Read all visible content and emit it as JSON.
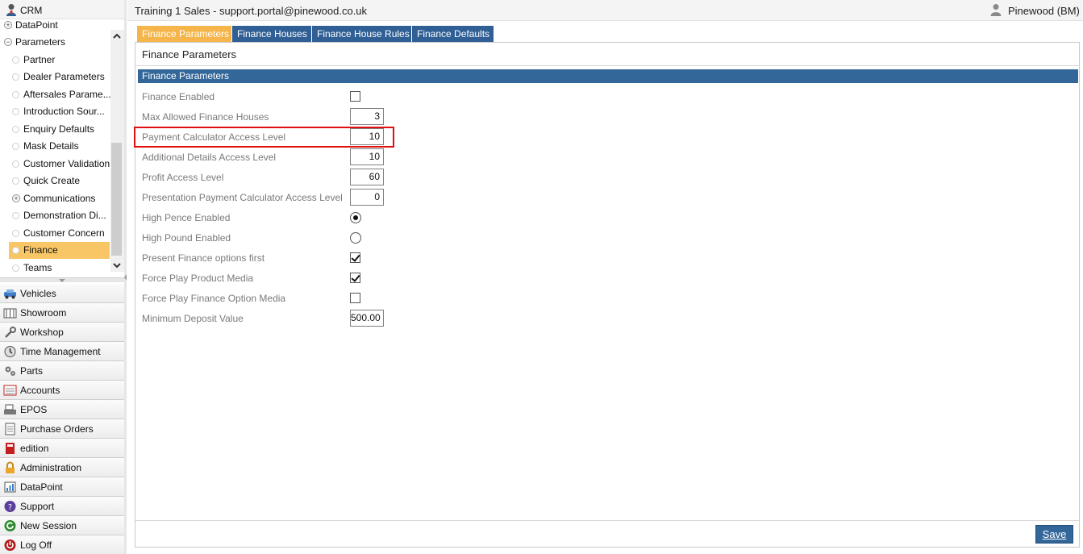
{
  "left_panel": {
    "header": {
      "label": "CRM"
    },
    "tree": [
      {
        "label": "DataPoint",
        "kind": "expandable",
        "symbol": "+"
      },
      {
        "label": "Parameters",
        "kind": "expandable",
        "symbol": "−"
      },
      {
        "label": "Partner",
        "kind": "leaf"
      },
      {
        "label": "Dealer Parameters",
        "kind": "leaf"
      },
      {
        "label": "Aftersales Parame...",
        "kind": "leaf"
      },
      {
        "label": "Introduction Sour...",
        "kind": "leaf"
      },
      {
        "label": "Enquiry Defaults",
        "kind": "leaf"
      },
      {
        "label": "Mask Details",
        "kind": "leaf"
      },
      {
        "label": "Customer Validation",
        "kind": "leaf"
      },
      {
        "label": "Quick Create",
        "kind": "leaf"
      },
      {
        "label": "Communications",
        "kind": "expandable",
        "symbol": "+"
      },
      {
        "label": "Demonstration Di...",
        "kind": "leaf"
      },
      {
        "label": "Customer Concern",
        "kind": "leaf"
      },
      {
        "label": "Finance",
        "kind": "leaf",
        "selected": true
      },
      {
        "label": "Teams",
        "kind": "leaf"
      }
    ],
    "modules": [
      {
        "label": "Vehicles",
        "icon": "car-icon"
      },
      {
        "label": "Showroom",
        "icon": "showroom-icon"
      },
      {
        "label": "Workshop",
        "icon": "wrench-icon"
      },
      {
        "label": "Time Management",
        "icon": "clock-icon"
      },
      {
        "label": "Parts",
        "icon": "gears-icon"
      },
      {
        "label": "Accounts",
        "icon": "ledger-icon"
      },
      {
        "label": "EPOS",
        "icon": "till-icon"
      },
      {
        "label": "Purchase Orders",
        "icon": "document-icon"
      },
      {
        "label": "edition",
        "icon": "red-book-icon"
      },
      {
        "label": "Administration",
        "icon": "padlock-icon"
      },
      {
        "label": "DataPoint",
        "icon": "datapoint-icon"
      },
      {
        "label": "Support",
        "icon": "support-icon"
      },
      {
        "label": "New Session",
        "icon": "refresh-icon"
      },
      {
        "label": "Log Off",
        "icon": "power-icon"
      }
    ]
  },
  "topbar": {
    "title": "Training 1 Sales - support.portal@pinewood.co.uk",
    "user": "Pinewood (BM)"
  },
  "tabs": [
    {
      "label": "Finance Parameters",
      "active": true
    },
    {
      "label": "Finance Houses",
      "active": false
    },
    {
      "label": "Finance House Rules",
      "active": false
    },
    {
      "label": "Finance Defaults",
      "active": false
    }
  ],
  "panel": {
    "title": "Finance Parameters",
    "section": "Finance Parameters",
    "fields": [
      {
        "label": "Finance Enabled",
        "type": "checkbox",
        "checked": false
      },
      {
        "label": "Max Allowed Finance Houses",
        "type": "number",
        "value": "3"
      },
      {
        "label": "Payment Calculator Access Level",
        "type": "number",
        "value": "10",
        "highlighted": true
      },
      {
        "label": "Additional Details Access Level",
        "type": "number",
        "value": "10"
      },
      {
        "label": "Profit Access Level",
        "type": "number",
        "value": "60"
      },
      {
        "label": "Presentation Payment Calculator Access Level",
        "type": "number",
        "value": "0"
      },
      {
        "label": "High Pence Enabled",
        "type": "radio",
        "checked": true
      },
      {
        "label": "High Pound Enabled",
        "type": "radio",
        "checked": false
      },
      {
        "label": "Present Finance options first",
        "type": "checkbox",
        "checked": true
      },
      {
        "label": "Force Play Product Media",
        "type": "checkbox",
        "checked": true
      },
      {
        "label": "Force Play Finance Option Media",
        "type": "checkbox",
        "checked": false
      },
      {
        "label": "Minimum Deposit Value",
        "type": "number",
        "value": "500.00"
      }
    ],
    "save_label": "Save"
  },
  "colors": {
    "tab_bg": "#2f5f95",
    "tab_active_bg": "#f6b54a",
    "section_bar": "#336699",
    "selected_tree_item": "#f9c665",
    "highlight_box": "#e01010",
    "save_button": "#336699"
  }
}
